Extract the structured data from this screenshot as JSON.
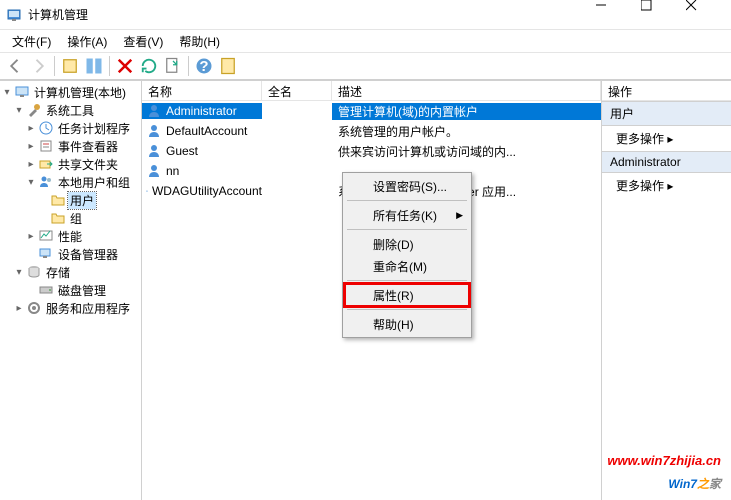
{
  "title": "计算机管理",
  "menubar": {
    "file": "文件(F)",
    "action": "操作(A)",
    "view": "查看(V)",
    "help": "帮助(H)"
  },
  "tree": {
    "root": "计算机管理(本地)",
    "sysTools": "系统工具",
    "scheduler": "任务计划程序",
    "eventViewer": "事件查看器",
    "sharedFolders": "共享文件夹",
    "localUsersGroups": "本地用户和组",
    "users": "用户",
    "groups": "组",
    "performance": "性能",
    "deviceMgr": "设备管理器",
    "storage": "存储",
    "diskMgmt": "磁盘管理",
    "services": "服务和应用程序"
  },
  "columns": {
    "name": "名称",
    "fullName": "全名",
    "desc": "描述"
  },
  "rows": [
    {
      "name": "Administrator",
      "full": "",
      "desc": "管理计算机(域)的内置帐户",
      "sel": true
    },
    {
      "name": "DefaultAccount",
      "full": "",
      "desc": "系统管理的用户帐户。",
      "sel": false
    },
    {
      "name": "Guest",
      "full": "",
      "desc": "供来宾访问计算机或访问域的内...",
      "sel": false
    },
    {
      "name": "nn",
      "full": "",
      "desc": "",
      "sel": false
    },
    {
      "name": "WDAGUtilityAccount",
      "full": "",
      "desc": "系统为 Windows Defender 应用...",
      "sel": false
    }
  ],
  "ctxmenu": {
    "setPwd": "设置密码(S)...",
    "allTasks": "所有任务(K)",
    "delete": "删除(D)",
    "rename": "重命名(M)",
    "properties": "属性(R)",
    "help": "帮助(H)"
  },
  "actions": {
    "title": "操作",
    "users": "用户",
    "more": "更多操作",
    "admin": "Administrator"
  },
  "watermark": {
    "url": "www.win7zhijia.cn",
    "brand1": "Win7",
    "brand2": "之",
    "brand3": "家"
  }
}
